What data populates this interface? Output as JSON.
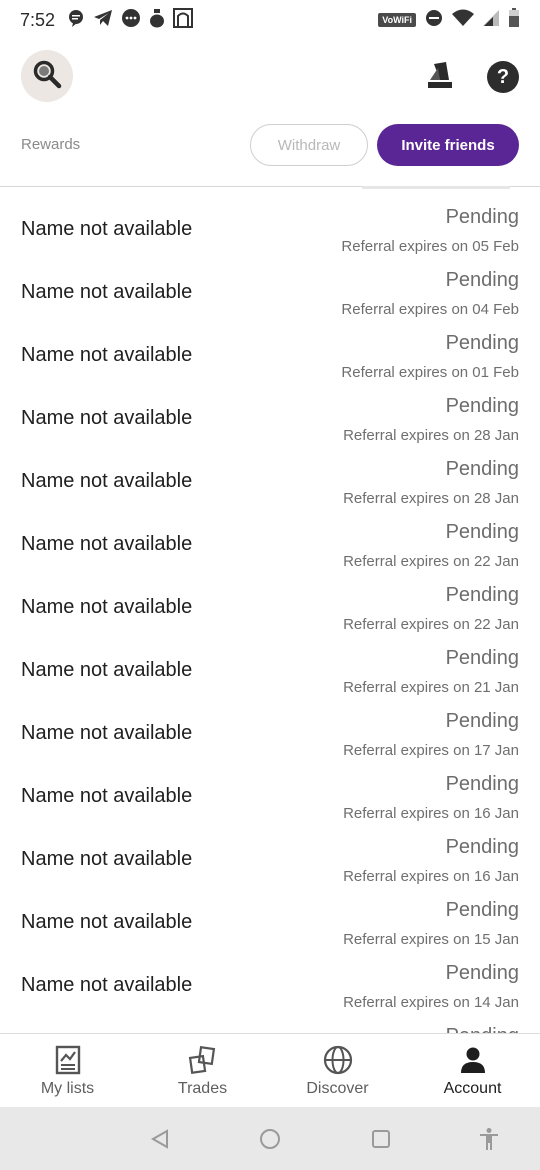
{
  "status_bar": {
    "time": "7:52",
    "network_badge": "VoWiFi",
    "left_icons": [
      "chat-bubble-icon",
      "telegram-icon",
      "messages-icon",
      "money-bag-icon",
      "app-icon"
    ],
    "right_icons": [
      "do-not-disturb-icon",
      "wifi-icon",
      "signal-icon",
      "battery-icon"
    ]
  },
  "header": {
    "search_icon": "search-icon",
    "brand_icon": "brand-logo-icon",
    "help_label": "?"
  },
  "rewards_bar": {
    "title": "Rewards",
    "withdraw_label": "Withdraw",
    "invite_label": "Invite friends"
  },
  "referrals": [
    {
      "name": "Name not available",
      "status": "Pending",
      "expires": "Referral expires on 05 Feb"
    },
    {
      "name": "Name not available",
      "status": "Pending",
      "expires": "Referral expires on 04 Feb"
    },
    {
      "name": "Name not available",
      "status": "Pending",
      "expires": "Referral expires on 01 Feb"
    },
    {
      "name": "Name not available",
      "status": "Pending",
      "expires": "Referral expires on 28 Jan"
    },
    {
      "name": "Name not available",
      "status": "Pending",
      "expires": "Referral expires on 28 Jan"
    },
    {
      "name": "Name not available",
      "status": "Pending",
      "expires": "Referral expires on 22 Jan"
    },
    {
      "name": "Name not available",
      "status": "Pending",
      "expires": "Referral expires on 22 Jan"
    },
    {
      "name": "Name not available",
      "status": "Pending",
      "expires": "Referral expires on 21 Jan"
    },
    {
      "name": "Name not available",
      "status": "Pending",
      "expires": "Referral expires on 17 Jan"
    },
    {
      "name": "Name not available",
      "status": "Pending",
      "expires": "Referral expires on 16 Jan"
    },
    {
      "name": "Name not available",
      "status": "Pending",
      "expires": "Referral expires on 16 Jan"
    },
    {
      "name": "Name not available",
      "status": "Pending",
      "expires": "Referral expires on 15 Jan"
    },
    {
      "name": "Name not available",
      "status": "Pending",
      "expires": "Referral expires on 14 Jan"
    },
    {
      "name": "",
      "status": "Pending",
      "expires": ""
    }
  ],
  "bottom_nav": {
    "items": [
      {
        "label": "My lists",
        "icon": "chart-list-icon"
      },
      {
        "label": "Trades",
        "icon": "trades-icon"
      },
      {
        "label": "Discover",
        "icon": "globe-icon"
      },
      {
        "label": "Account",
        "icon": "person-icon"
      }
    ],
    "active": "Account"
  },
  "system_nav": [
    "back-icon",
    "home-icon",
    "recents-icon",
    "accessibility-icon"
  ],
  "colors": {
    "accent": "#5a2594",
    "search_bg": "#ece7e3",
    "status_text": "#6d6d6d",
    "system_nav_bg": "#e8e8e8"
  }
}
